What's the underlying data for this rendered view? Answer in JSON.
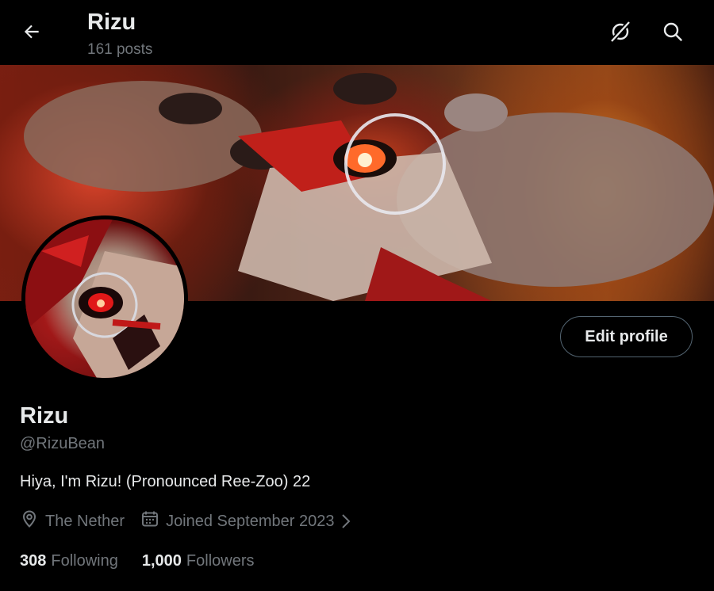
{
  "header": {
    "title": "Rizu",
    "post_count": "161 posts"
  },
  "icons": {
    "back": "arrow-left-icon",
    "grok": "grok-icon",
    "search": "search-icon",
    "location": "location-pin-icon",
    "calendar": "calendar-icon",
    "chevron": "chevron-right-icon"
  },
  "profile": {
    "edit_label": "Edit profile",
    "display_name": "Rizu",
    "handle": "@RizuBean",
    "bio": "Hiya, I'm Rizu! (Pronounced Ree-Zoo) 22",
    "location": "The Nether",
    "joined": "Joined September 2023",
    "following_count": "308",
    "following_label": "Following",
    "followers_count": "1,000",
    "followers_label": "Followers"
  },
  "colors": {
    "background": "#000000",
    "text_primary": "#e7e9ea",
    "text_secondary": "#71767b",
    "button_border": "#536471"
  }
}
